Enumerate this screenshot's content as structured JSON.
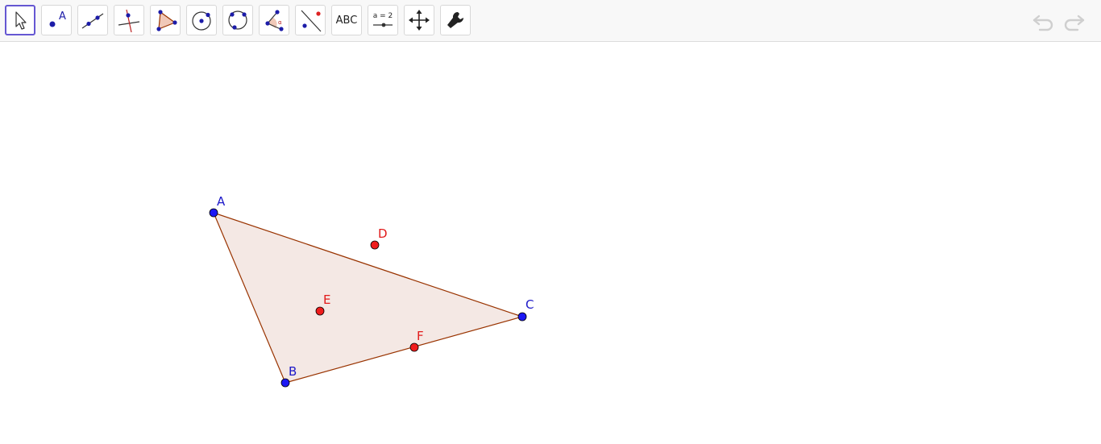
{
  "toolbar": {
    "tools": [
      {
        "id": "move",
        "icon": "cursor-arrow-icon",
        "selected": true
      },
      {
        "id": "point",
        "icon": "point-icon",
        "label": "A"
      },
      {
        "id": "line",
        "icon": "line-through-points-icon"
      },
      {
        "id": "perpendicular",
        "icon": "perpendicular-line-icon"
      },
      {
        "id": "polygon",
        "icon": "polygon-icon"
      },
      {
        "id": "circle-center",
        "icon": "circle-center-point-icon"
      },
      {
        "id": "circle-three",
        "icon": "circle-three-points-icon"
      },
      {
        "id": "angle",
        "icon": "angle-icon",
        "label": "α"
      },
      {
        "id": "reflect",
        "icon": "reflect-about-line-icon"
      },
      {
        "id": "text",
        "icon": "text-icon",
        "label": "ABC"
      },
      {
        "id": "slider",
        "icon": "slider-icon",
        "label": "a = 2"
      },
      {
        "id": "move-view",
        "icon": "move-graphics-view-icon"
      },
      {
        "id": "tools",
        "icon": "wrench-icon"
      }
    ],
    "undo_icon": "undo-icon",
    "redo_icon": "redo-icon"
  },
  "colors": {
    "blue_point": "#1c18f4",
    "red_point": "#ef1c1c",
    "triangle_edge": "#993300",
    "triangle_fill": "#f4e8e4",
    "selected_border": "#6557d2",
    "toolbar_bg": "#f8f8f8",
    "icon_blue": "#1c1ca8",
    "label_blue": "#1c18c8",
    "label_red": "#e11b1b"
  },
  "points": {
    "A": {
      "label": "A"
    },
    "B": {
      "label": "B"
    },
    "C": {
      "label": "C"
    },
    "D": {
      "label": "D"
    },
    "E": {
      "label": "E"
    },
    "F": {
      "label": "F"
    }
  }
}
